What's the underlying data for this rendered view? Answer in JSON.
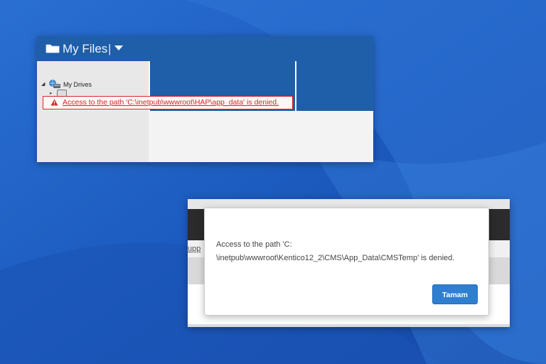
{
  "my_files_window": {
    "title": "My Files",
    "separator": "|",
    "tree": {
      "root_label": "My Drives"
    },
    "error_message": "Access to the path 'C:\\inetpub\\wwwroot\\HAP\\app_data' is denied."
  },
  "dialog_window": {
    "link_fragment": "upp",
    "message_line1": "Access to the path 'C:",
    "message_line2": "\\inetpub\\wwwroot\\Kentico12_2\\CMS\\App_Data\\CMSTemp' is denied.",
    "ok_label": "Tamam"
  },
  "icons": {
    "window_title_icon": "folder-icon",
    "dropdown": "dropdown-triangle-icon",
    "tree_root": "drives-globe-icon",
    "error": "warning-triangle-icon"
  },
  "colors": {
    "desktop_background": "#1f5fc4",
    "title_bar": "#1f5ea8",
    "error_red": "#d62a2a",
    "ok_button": "#2f7fd1"
  }
}
